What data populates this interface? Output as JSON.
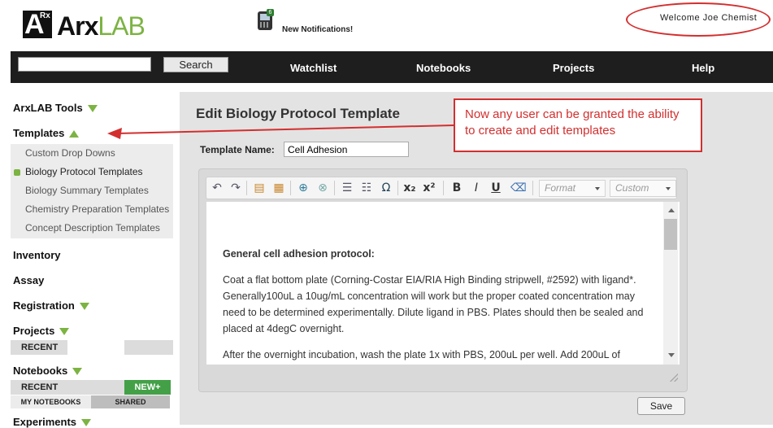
{
  "header": {
    "logo_text": "Arx",
    "logo_text_lab": "LAB",
    "logo_mark": "A",
    "logo_mark_sup": "Rx",
    "notifications_badge": "6",
    "notifications_label": "New Notifications!",
    "welcome": "Welcome Joe Chemist",
    "accent_color": "#7cb342",
    "annotation_color": "#d32f2f"
  },
  "nav": {
    "search_placeholder": "",
    "search_button": "Search",
    "links": [
      "Watchlist",
      "Notebooks",
      "Projects",
      "Help"
    ]
  },
  "sidebar": {
    "tools": "ArxLAB Tools",
    "templates": "Templates",
    "template_items": [
      "Custom Drop Downs",
      "Biology Protocol Templates",
      "Biology Summary Templates",
      "Chemistry Preparation Templates",
      "Concept Description Templates"
    ],
    "inventory": "Inventory",
    "assay": "Assay",
    "registration": "Registration",
    "projects": "Projects",
    "projects_recent": "RECENT",
    "notebooks": "Notebooks",
    "notebooks_recent": "RECENT",
    "new_button": "NEW+",
    "my_notebooks_tab": "MY NOTEBOOKS",
    "shared_tab": "SHARED",
    "experiments": "Experiments"
  },
  "main": {
    "title": "Edit Biology Protocol Template",
    "template_name_label": "Template Name:",
    "template_name_value": "Cell Adhesion",
    "callout": "Now any user can be granted the ability to create and edit templates",
    "toolbar": {
      "format_label": "Format",
      "custom_label": "Custom",
      "icons": [
        "undo-icon",
        "redo-icon",
        "paste-text-icon",
        "paste-word-icon",
        "link-icon",
        "unlink-icon",
        "numbered-list-icon",
        "bulleted-list-icon",
        "special-char-icon",
        "subscript-icon",
        "superscript-icon",
        "bold-icon",
        "italic-icon",
        "underline-icon",
        "remove-format-icon"
      ]
    },
    "content": {
      "heading": "General cell adhesion protocol:",
      "p1": "Coat a flat bottom plate (Corning-Costar EIA/RIA High Binding stripwell, #2592) with ligand*. Generally100uL a 10ug/mL concentration will work but the proper coated concentration may need to be determined experimentally. Dilute ligand in PBS. Plates should then be sealed and placed at 4degC overnight.",
      "p2": "After the overnight incubation, wash the plate 1x with PBS, 200uL per well. Add 200uL of"
    },
    "save_button": "Save"
  }
}
